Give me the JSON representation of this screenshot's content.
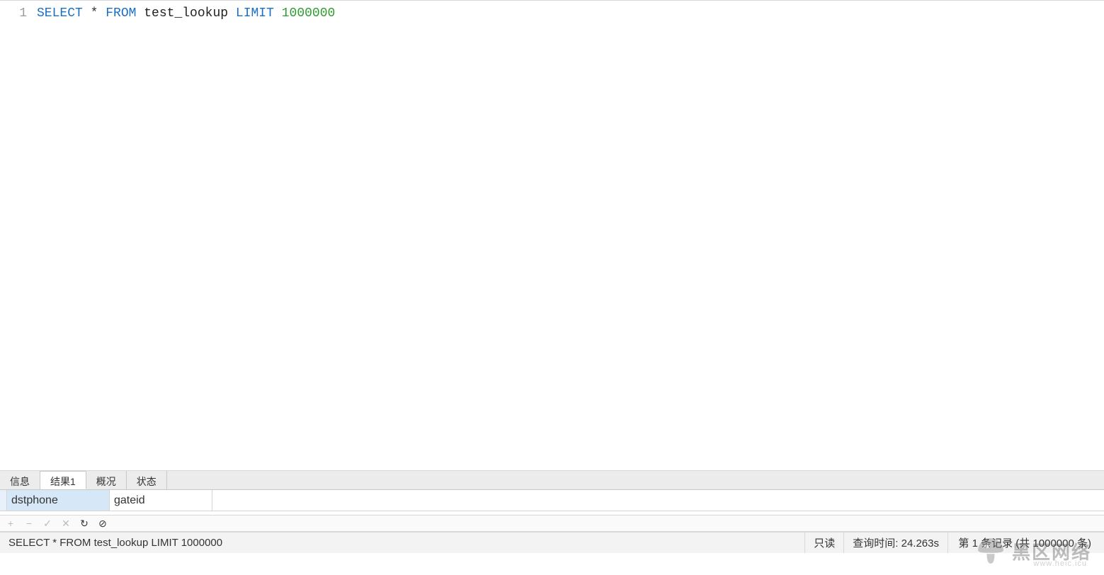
{
  "editor": {
    "gutter": [
      "1"
    ],
    "tokens": [
      {
        "cls": "kw",
        "t": "SELECT"
      },
      {
        "cls": "",
        "t": " * "
      },
      {
        "cls": "kw",
        "t": "FROM"
      },
      {
        "cls": "",
        "t": " "
      },
      {
        "cls": "id",
        "t": "test_lookup"
      },
      {
        "cls": "",
        "t": " "
      },
      {
        "cls": "kw",
        "t": "LIMIT"
      },
      {
        "cls": "",
        "t": " "
      },
      {
        "cls": "num",
        "t": "1000000"
      }
    ]
  },
  "tabs": [
    {
      "label": "信息",
      "active": false
    },
    {
      "label": "结果1",
      "active": true
    },
    {
      "label": "概况",
      "active": false
    },
    {
      "label": "状态",
      "active": false
    }
  ],
  "grid": {
    "columns": [
      {
        "name": "dstphone",
        "selected": true
      },
      {
        "name": "gateid",
        "selected": false
      }
    ]
  },
  "action_icons": [
    {
      "name": "add-row-icon",
      "glyph": "+",
      "enabled": false
    },
    {
      "name": "delete-row-icon",
      "glyph": "−",
      "enabled": false
    },
    {
      "name": "apply-icon",
      "glyph": "✓",
      "enabled": false
    },
    {
      "name": "cancel-icon",
      "glyph": "✕",
      "enabled": false
    },
    {
      "name": "refresh-icon",
      "glyph": "↻",
      "enabled": true,
      "dark": true
    },
    {
      "name": "stop-icon",
      "glyph": "⊘",
      "enabled": true,
      "dark": true
    }
  ],
  "status": {
    "query": "SELECT * FROM test_lookup LIMIT 1000000",
    "readonly": "只读",
    "time": "查询时间: 24.263s",
    "records": "第 1 条记录 (共 1000000 条)"
  },
  "watermark": {
    "text": "黑区网络",
    "sub": "www.heic.icu"
  }
}
